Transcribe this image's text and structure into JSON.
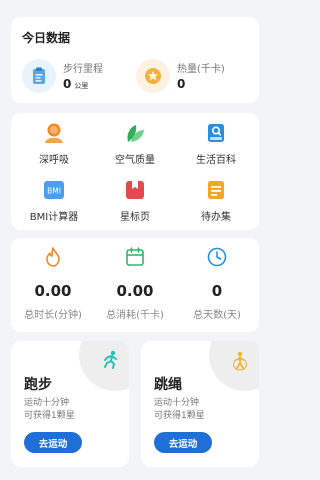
{
  "today": {
    "title": "今日数据",
    "steps": {
      "label": "步行里程",
      "value": "0",
      "unit": "公里"
    },
    "calories": {
      "label": "热量(千卡)",
      "value": "0"
    }
  },
  "tools": [
    {
      "label": "深呼吸",
      "icon": "person-icon"
    },
    {
      "label": "空气质量",
      "icon": "leaf-icon"
    },
    {
      "label": "生活百科",
      "icon": "book-icon"
    },
    {
      "label": "BMI计算器",
      "icon": "bmi-icon"
    },
    {
      "label": "星标页",
      "icon": "bookmark-icon"
    },
    {
      "label": "待办集",
      "icon": "todo-icon"
    }
  ],
  "summary": [
    {
      "value": "0.00",
      "label": "总时长(分钟)",
      "icon": "flame-icon"
    },
    {
      "value": "0.00",
      "label": "总消耗(千卡)",
      "icon": "calendar-icon"
    },
    {
      "value": "0",
      "label": "总天数(天)",
      "icon": "clock-icon"
    }
  ],
  "exercises": [
    {
      "title": "跑步",
      "desc1": "运动十分钟",
      "desc2": "可获得1颗星",
      "button": "去运动",
      "icon": "running-icon"
    },
    {
      "title": "跳绳",
      "desc1": "运动十分钟",
      "desc2": "可获得1颗星",
      "button": "去运动",
      "icon": "jump-rope-icon"
    }
  ],
  "colors": {
    "accent": "#1f6fd8",
    "orange": "#f39a3b",
    "green": "#3bb36b",
    "blue": "#2a8fdc",
    "red": "#e5484d"
  }
}
